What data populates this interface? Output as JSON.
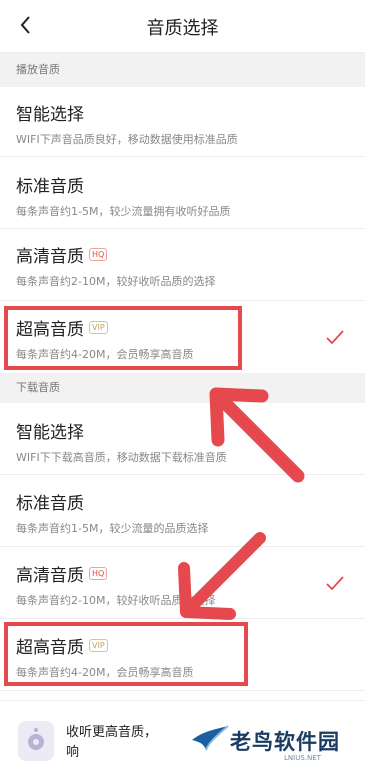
{
  "header": {
    "title": "音质选择"
  },
  "sections": {
    "playback": {
      "label": "播放音质",
      "options": [
        {
          "title": "智能选择",
          "desc": "WIFI下声音品质良好，移动数据使用标准品质",
          "badge": "",
          "selected": false
        },
        {
          "title": "标准音质",
          "desc": "每条声音约1-5M，较少流量拥有收听好品质",
          "badge": "",
          "selected": false
        },
        {
          "title": "高清音质",
          "desc": "每条声音约2-10M，较好收听品质的选择",
          "badge": "HQ",
          "selected": false
        },
        {
          "title": "超高音质",
          "desc": "每条声音约4-20M，会员畅享高音质",
          "badge": "VIP",
          "selected": true
        }
      ]
    },
    "download": {
      "label": "下载音质",
      "options": [
        {
          "title": "智能选择",
          "desc": "WIFI下下载高音质，移动数据下载标准音质",
          "badge": "",
          "selected": false
        },
        {
          "title": "标准音质",
          "desc": "每条声音约1-5M，较少流量的品质选择",
          "badge": "",
          "selected": false
        },
        {
          "title": "高清音质",
          "desc": "每条声音约2-10M，较好收听品质的选择",
          "badge": "HQ",
          "selected": true
        },
        {
          "title": "超高音质",
          "desc": "每条声音约4-20M，会员畅享高音质",
          "badge": "VIP",
          "selected": false
        }
      ]
    }
  },
  "banner": {
    "text": "收听更高音质，响"
  },
  "watermark": {
    "name": "老鸟软件园",
    "sub": "LNIUS.NET"
  },
  "colors": {
    "accent": "#e5484d",
    "hq": "#e84c3d",
    "vip": "#c8a35a"
  }
}
